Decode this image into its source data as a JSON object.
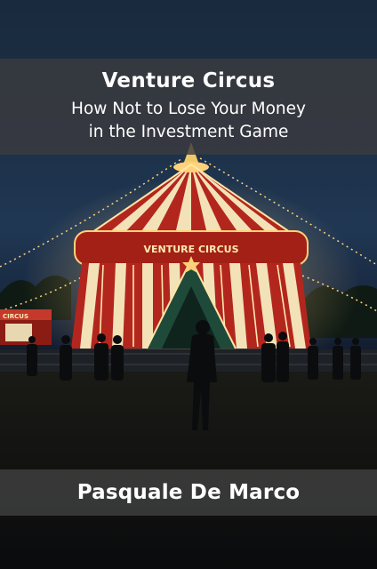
{
  "book": {
    "title": "Venture Circus",
    "subtitle_line1": "How Not to Lose Your Money",
    "subtitle_line2": "in the Investment Game",
    "author": "Pasquale De Marco"
  },
  "illustration": {
    "tent_sign": "VENTURE CIRCUS",
    "side_sign": "CIRCUS",
    "colors": {
      "tent_red": "#b3261e",
      "tent_cream": "#f3e2b8",
      "lights": "#ffd27a",
      "sky": "#1c3047"
    }
  }
}
